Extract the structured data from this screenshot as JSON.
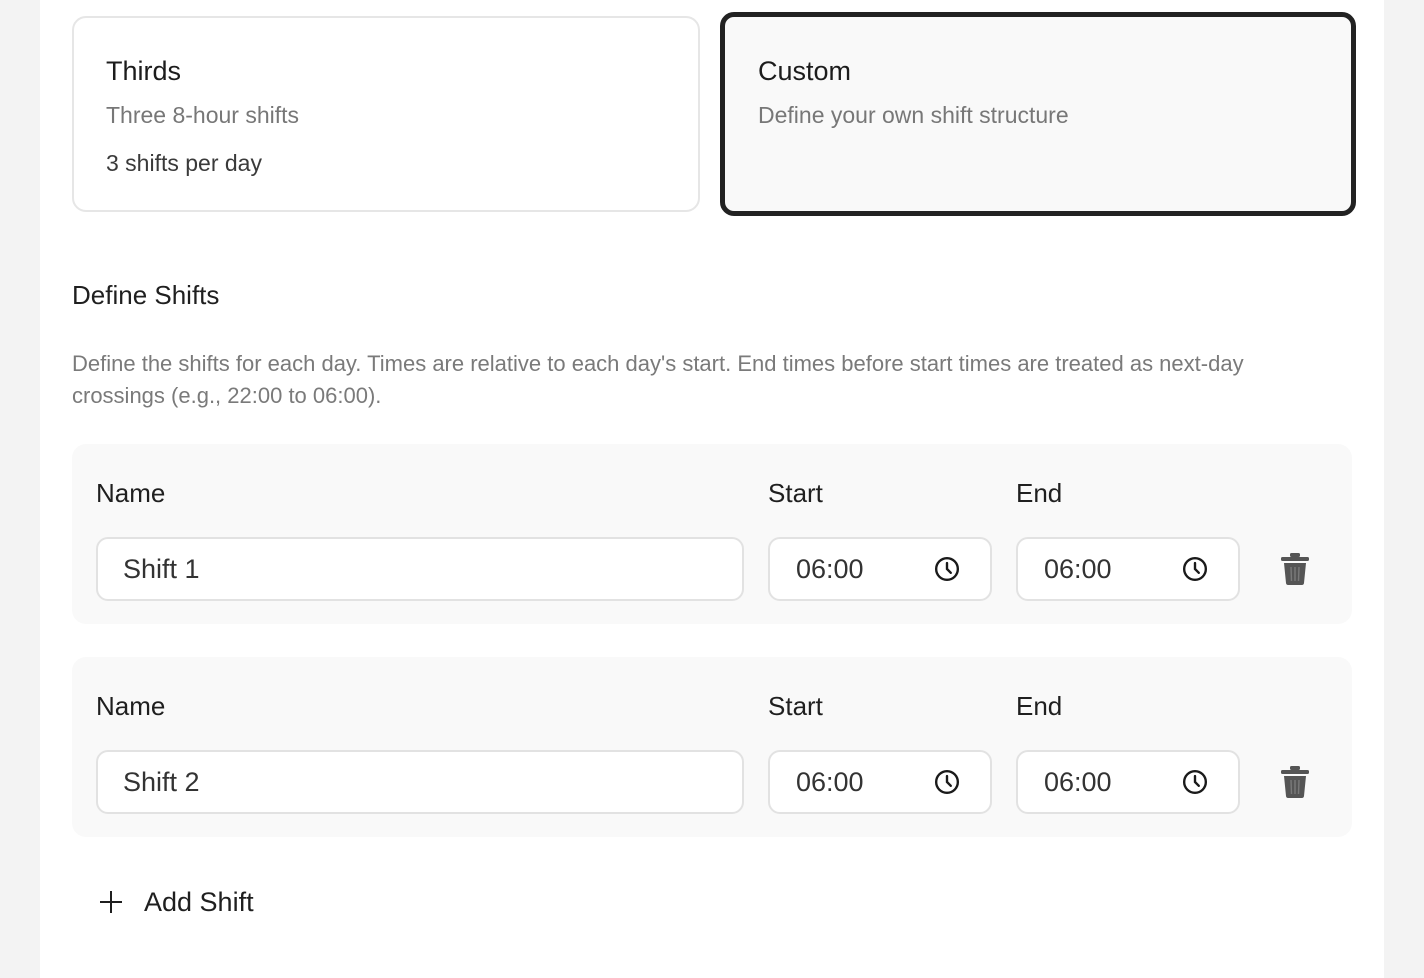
{
  "cards": {
    "thirds": {
      "title": "Thirds",
      "description": "Three 8-hour shifts",
      "meta": "3 shifts per day"
    },
    "custom": {
      "title": "Custom",
      "description": "Define your own shift structure",
      "selected": true
    }
  },
  "section": {
    "title": "Define Shifts",
    "description": "Define the shifts for each day. Times are relative to each day's start. End times before start times are treated as next-day crossings (e.g., 22:00 to 06:00)."
  },
  "labels": {
    "name": "Name",
    "start": "Start",
    "end": "End"
  },
  "shifts": [
    {
      "name": "Shift 1",
      "start": "06:00",
      "end": "06:00"
    },
    {
      "name": "Shift 2",
      "start": "06:00",
      "end": "06:00"
    }
  ],
  "actions": {
    "add_shift": "Add Shift"
  },
  "icons": {
    "time": "clock-icon",
    "delete": "trash-icon",
    "add": "plus-icon"
  },
  "colors": {
    "selected_border": "#222222",
    "muted_text": "#777777",
    "row_background": "#f9f9f9"
  }
}
